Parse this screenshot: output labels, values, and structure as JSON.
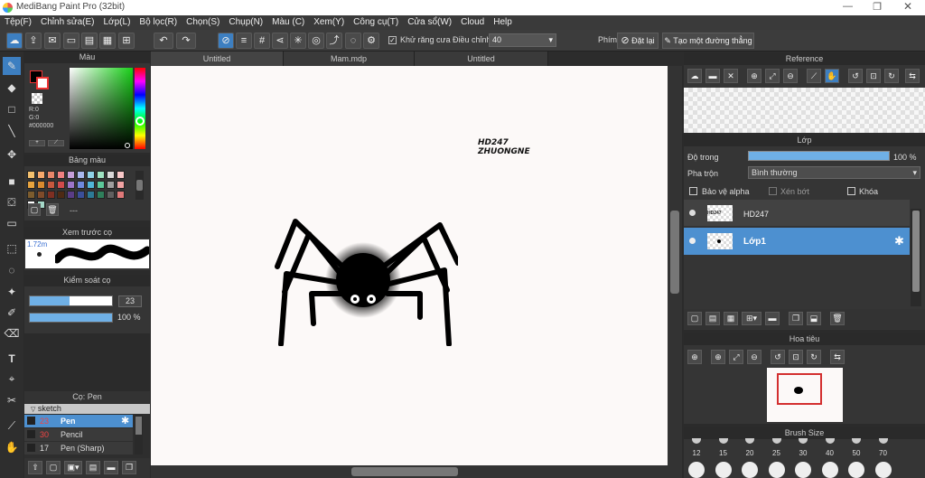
{
  "window": {
    "title": "MediBang Paint Pro (32bit)"
  },
  "menu": [
    "Tệp(F)",
    "Chỉnh sửa(E)",
    "Lớp(L)",
    "Bộ lọc(R)",
    "Chọn(S)",
    "Chụp(N)",
    "Màu (C)",
    "Xem(Y)",
    "Công cụ(T)",
    "Cửa sổ(W)",
    "Cloud",
    "Help"
  ],
  "toolbar": {
    "antialias_label": "Khử răng cưa",
    "adjust_label": "Điều chỉnh",
    "adjust_value": "40",
    "keys_label": "Phím",
    "reset_label": "Đặt lại",
    "straight_label": "Tạo một đường thẳng"
  },
  "color_panel": {
    "title": "Màu",
    "r": "R:0",
    "g": "G:0",
    "b": "B:0",
    "hex": "#000000"
  },
  "palette_panel": {
    "title": "Bảng màu",
    "palette_colors": [
      "#f5c16e",
      "#f7a86c",
      "#e8866a",
      "#f08181",
      "#c69fd9",
      "#a9b8ee",
      "#8fd2e8",
      "#9fe3c2",
      "#d9d9d9",
      "#f9c9c9",
      "#e7a33e",
      "#d98a2f",
      "#c6583e",
      "#d04b4b",
      "#9c75c8",
      "#6f89dd",
      "#51b5d8",
      "#5cc89a",
      "#9f9f9f",
      "#f1a3a3",
      "#7c5c2e",
      "#7f4b2a",
      "#7e2f22",
      "#4d2a14",
      "#5a3d86",
      "#3b4f99",
      "#2d7a96",
      "#2f7f5b",
      "#606060",
      "#e07979",
      "#ffffff",
      "#a5d8c8"
    ],
    "mode_text": "---"
  },
  "brush_preview": {
    "title": "Xem trước cọ",
    "size": "1.72m"
  },
  "brush_control": {
    "title": "Kiểm soát cọ",
    "size_value": "23",
    "opacity_value": "100 %"
  },
  "brush_panel": {
    "title": "Cọ: Pen",
    "group": "sketch",
    "items": [
      {
        "size": "23",
        "name": "Pen"
      },
      {
        "size": "30",
        "name": "Pencil"
      },
      {
        "size": "17",
        "name": "Pen (Sharp)"
      }
    ]
  },
  "tabs": [
    "Untitled",
    "Mam.mdp",
    "Untitled"
  ],
  "canvas_text": {
    "line1": "HD247",
    "line2": "ZHUONGNE"
  },
  "reference_panel": {
    "title": "Reference"
  },
  "layer_panel": {
    "title": "Lớp",
    "opacity_label": "Độ trong",
    "opacity_value": "100 %",
    "blend_label": "Pha trộn",
    "blend_value": "Bình thường",
    "protect_alpha": "Bảo vệ alpha",
    "clipping": "Xén bớt",
    "lock": "Khóa",
    "layers": [
      {
        "name": "HD247",
        "thumb": "HD247"
      },
      {
        "name": "Lớp1"
      }
    ]
  },
  "navigator_panel": {
    "title": "Hoa tiêu"
  },
  "brush_size_panel": {
    "title": "Brush Size",
    "sizes": [
      "12",
      "15",
      "20",
      "25",
      "30",
      "40",
      "50",
      "70"
    ]
  }
}
